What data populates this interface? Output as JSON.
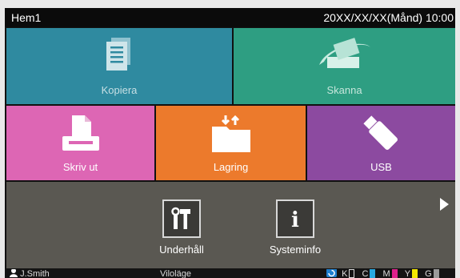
{
  "header": {
    "title": "Hem1",
    "datetime": "20XX/XX/XX(Månd) 10:00"
  },
  "tiles": {
    "copy": {
      "label": "Kopiera",
      "color": "#2f8aa0"
    },
    "scan": {
      "label": "Skanna",
      "color": "#2e9e82"
    },
    "print": {
      "label": "Skriv ut",
      "color": "#dd66b4"
    },
    "storage": {
      "label": "Lagring",
      "color": "#ec7a2c"
    },
    "usb": {
      "label": "USB",
      "color": "#8c4aa0"
    }
  },
  "tools": {
    "maintenance": {
      "label": "Underhåll",
      "icon": "tools-icon"
    },
    "sysinfo": {
      "label": "Systeminfo",
      "icon": "info-icon"
    }
  },
  "statusbar": {
    "user": "J.Smith",
    "mode": "Viloläge",
    "inks": [
      {
        "name": "K",
        "color": "#111111"
      },
      {
        "name": "C",
        "color": "#29a8e0"
      },
      {
        "name": "M",
        "color": "#e0208c"
      },
      {
        "name": "Y",
        "color": "#f3e600"
      },
      {
        "name": "G",
        "color": "#9a9a9a"
      }
    ]
  }
}
